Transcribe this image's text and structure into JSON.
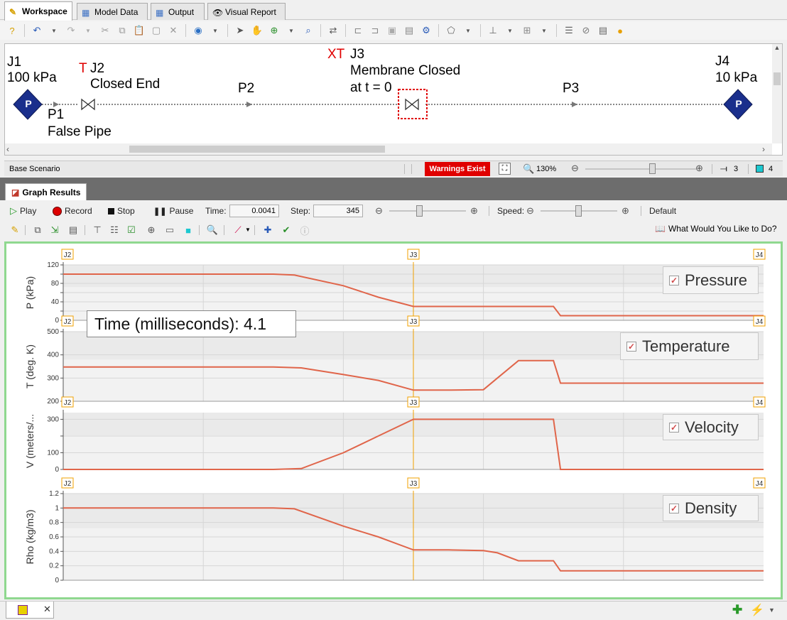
{
  "tabs": [
    {
      "label": "Workspace",
      "active": true
    },
    {
      "label": "Model Data",
      "active": false
    },
    {
      "label": "Output",
      "active": false
    },
    {
      "label": "Visual Report",
      "active": false
    }
  ],
  "workspace": {
    "j1_name": "J1",
    "j1_value": "100 kPa",
    "j2_flag": "T",
    "j2_name": "J2",
    "j2_desc": "Closed End",
    "j3_flag": "XT",
    "j3_name": "J3",
    "j3_desc1": "Membrane Closed",
    "j3_desc2": "at t = 0",
    "j4_name": "J4",
    "j4_value": "10 kPa",
    "p1_name": "P1",
    "p1_desc": "False Pipe",
    "p2_name": "P2",
    "p3_name": "P3",
    "pump_letter": "P"
  },
  "status": {
    "scenario": "Base Scenario",
    "warnings": "Warnings Exist",
    "zoom": "130%",
    "pipes_count": "3",
    "junctions_count": "4"
  },
  "graph_tab": "Graph Results",
  "controls": {
    "play": "Play",
    "record": "Record",
    "stop": "Stop",
    "pause": "Pause",
    "time_label": "Time:",
    "time_value": "0.0041",
    "step_label": "Step:",
    "step_value": "345",
    "speed_label": "Speed:",
    "default_label": "Default"
  },
  "help_link": "What Would You Like to Do?",
  "time_readout": "Time (milliseconds): 4.1",
  "colors": {
    "line": "#e0654a",
    "marker": "#f0a000",
    "accent_green": "#8fd88f",
    "warning_red": "#e00000"
  },
  "chart_data": [
    {
      "type": "line",
      "legend": "Pressure",
      "ylabel": "P (kPa)",
      "yticks": [
        0,
        20,
        40,
        60,
        80,
        100,
        120
      ],
      "ytick_labels": [
        "0",
        "",
        "40",
        "",
        "80",
        "",
        "120"
      ],
      "ylim": [
        0,
        120
      ],
      "x": [
        0,
        0.1,
        0.2,
        0.3,
        0.33,
        0.4,
        0.45,
        0.5,
        0.55,
        0.7,
        0.71,
        0.8,
        0.9,
        1.0
      ],
      "values": [
        100,
        100,
        100,
        100,
        98,
        75,
        50,
        30,
        30,
        30,
        10,
        10,
        10,
        10
      ],
      "markers": [
        "J2",
        "J3",
        "J4"
      ]
    },
    {
      "type": "line",
      "legend": "Temperature",
      "ylabel": "T (deg. K)",
      "yticks": [
        200,
        300,
        400,
        500
      ],
      "ytick_labels": [
        "200",
        "300",
        "400",
        "500"
      ],
      "ylim": [
        200,
        500
      ],
      "x": [
        0,
        0.1,
        0.2,
        0.3,
        0.34,
        0.4,
        0.45,
        0.5,
        0.55,
        0.6,
        0.62,
        0.65,
        0.7,
        0.71,
        0.8,
        0.9,
        1.0
      ],
      "values": [
        348,
        348,
        348,
        348,
        344,
        315,
        290,
        248,
        248,
        250,
        300,
        375,
        375,
        278,
        278,
        278,
        278
      ],
      "markers": [
        "J2",
        "J3",
        "J4"
      ]
    },
    {
      "type": "line",
      "legend": "Velocity",
      "ylabel": "V (meters/...",
      "yticks": [
        0,
        100,
        200,
        300
      ],
      "ytick_labels": [
        "0",
        "100",
        "",
        "300"
      ],
      "ylim": [
        0,
        340
      ],
      "x": [
        0,
        0.1,
        0.2,
        0.3,
        0.34,
        0.4,
        0.45,
        0.5,
        0.55,
        0.6,
        0.7,
        0.71,
        0.8,
        0.9,
        1.0
      ],
      "values": [
        0,
        0,
        0,
        0,
        5,
        100,
        200,
        300,
        300,
        300,
        300,
        0,
        0,
        0,
        0
      ],
      "markers": [
        "J2",
        "J3",
        "J4"
      ]
    },
    {
      "type": "line",
      "legend": "Density",
      "ylabel": "Rho (kg/m3)",
      "yticks": [
        0,
        0.2,
        0.4,
        0.6,
        0.8,
        1.0,
        1.2
      ],
      "ytick_labels": [
        "0",
        "0.2",
        "0.4",
        "0.6",
        "0.8",
        "1",
        "1.2"
      ],
      "ylim": [
        0,
        1.2
      ],
      "x": [
        0,
        0.1,
        0.2,
        0.3,
        0.33,
        0.4,
        0.45,
        0.5,
        0.55,
        0.6,
        0.62,
        0.65,
        0.7,
        0.71,
        0.8,
        0.9,
        1.0
      ],
      "values": [
        1.0,
        1.0,
        1.0,
        1.0,
        0.99,
        0.75,
        0.6,
        0.42,
        0.42,
        0.41,
        0.38,
        0.27,
        0.27,
        0.13,
        0.13,
        0.13,
        0.13
      ],
      "markers": [
        "J2",
        "J3",
        "J4"
      ]
    }
  ]
}
